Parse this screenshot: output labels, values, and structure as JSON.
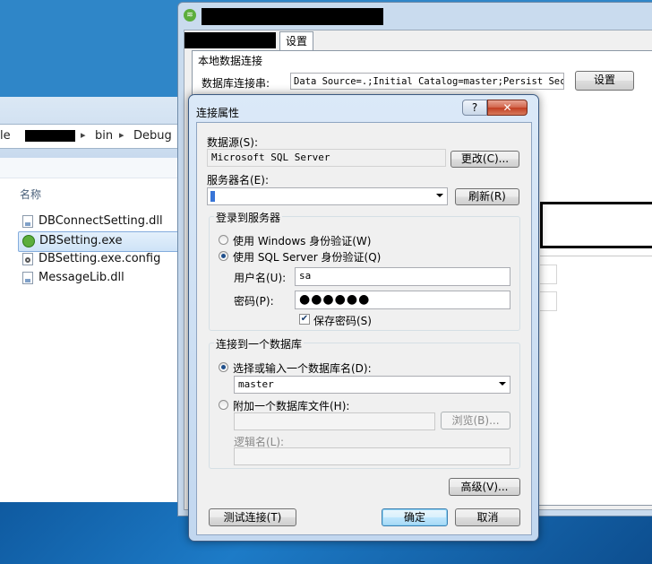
{
  "explorer": {
    "breadcrumb": {
      "prefix": "le",
      "sep1": "▸",
      "crumb_bin": "bin",
      "sep2": "▸",
      "crumb_debug": "Debug"
    },
    "column_header": "名称",
    "files": [
      {
        "name": "DBConnectSetting.dll",
        "icon": "dll-file-icon",
        "selected": false
      },
      {
        "name": "DBSetting.exe",
        "icon": "app-exe-icon",
        "selected": true
      },
      {
        "name": "DBSetting.exe.config",
        "icon": "config-file-icon",
        "selected": false
      },
      {
        "name": "MessageLib.dll",
        "icon": "dll-file-icon",
        "selected": false
      }
    ]
  },
  "main_window": {
    "tab_label": "设置",
    "group_label": "本地数据连接",
    "conn_string_label": "数据库连接串:",
    "conn_string_value": "Data Source=.;Initial Catalog=master;Persist Security Info=True",
    "setting_button": "设置"
  },
  "dialog": {
    "title": "连接属性",
    "help_glyph": "?",
    "close_glyph": "✕",
    "datasource_label": "数据源(S):",
    "datasource_value": "Microsoft SQL Server",
    "change_button": "更改(C)...",
    "server_label": "服务器名(E):",
    "server_value": "",
    "refresh_button": "刷新(R)",
    "login_group": {
      "title": "登录到服务器",
      "windows_auth": "使用 Windows 身份验证(W)",
      "sql_auth": "使用 SQL Server 身份验证(Q)",
      "selected_auth": "sql",
      "username_label": "用户名(U):",
      "username_value": "sa",
      "password_label": "密码(P):",
      "password_mask": "●●●●●●",
      "save_password_label": "保存密码(S)",
      "save_password_checked": true,
      "check_glyph": "✔"
    },
    "db_group": {
      "title": "连接到一个数据库",
      "select_db_label": "选择或输入一个数据库名(D):",
      "db_value": "master",
      "attach_label": "附加一个数据库文件(H):",
      "browse_button": "浏览(B)...",
      "logical_name_label": "逻辑名(L):",
      "selected_option": "select"
    },
    "advanced_button": "高级(V)...",
    "test_button": "测试连接(T)",
    "ok_button": "确定",
    "cancel_button": "取消"
  },
  "colors": {
    "dialog_frame": "#c2d7ef",
    "default_button_border": "#3c7fb1",
    "close_button": "#c23e22",
    "selection": "#cfe3f7"
  }
}
